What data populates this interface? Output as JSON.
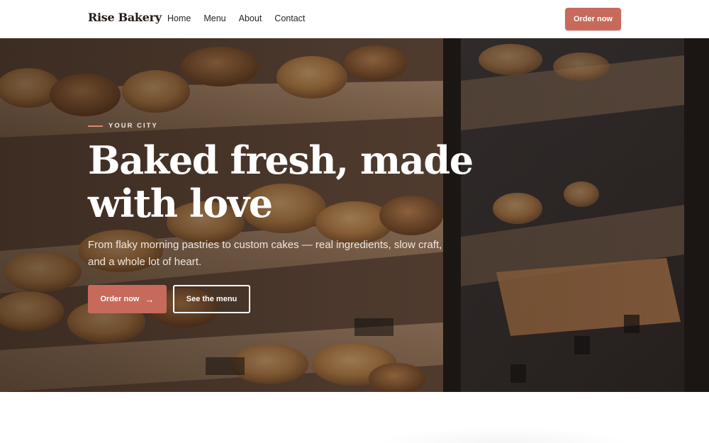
{
  "header": {
    "brand": "Rise Bakery",
    "nav": [
      {
        "label": "Home"
      },
      {
        "label": "Menu"
      },
      {
        "label": "About"
      },
      {
        "label": "Contact"
      }
    ],
    "cta_label": "Order now"
  },
  "hero": {
    "eyebrow": "YOUR CITY",
    "headline": "Baked fresh, made with love",
    "subtext": "From flaky morning pastries to custom cakes — real ingredients, slow craft, and a whole lot of heart.",
    "primary_button": "Order now",
    "primary_arrow": "→",
    "secondary_button": "See the menu"
  },
  "colors": {
    "accent": "#c76a5b",
    "accent_line": "#d98a76",
    "dark_text": "#221b17"
  }
}
